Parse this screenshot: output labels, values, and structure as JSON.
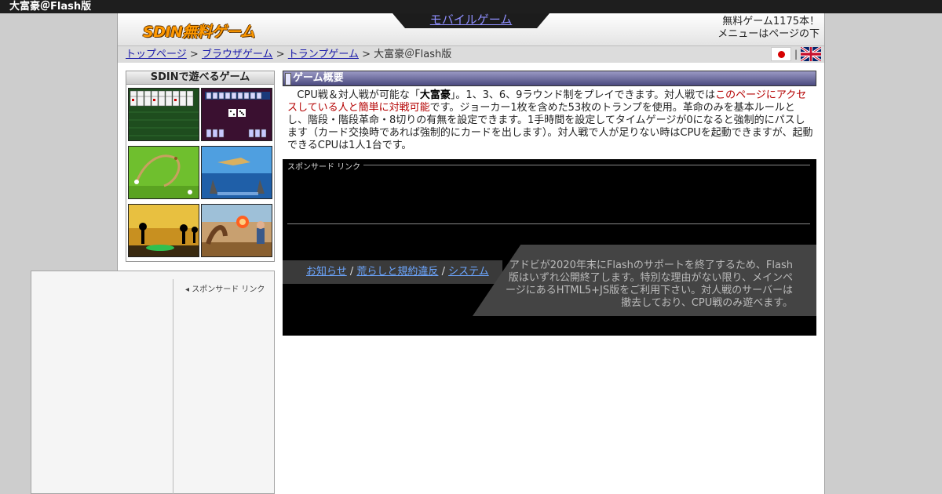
{
  "window": {
    "title": "大富豪＠Flash版"
  },
  "header": {
    "logo_text": "SDIN無料ゲーム",
    "mobile_link": "モバイルゲーム",
    "game_count": "無料ゲーム1175本！",
    "menu_hint": "メニューはページの下"
  },
  "breadcrumb": {
    "items": [
      "トップページ",
      "ブラウザゲーム",
      "トランプゲーム"
    ],
    "separator": ">",
    "current": "大富豪＠Flash版"
  },
  "flags": {
    "separator": "|"
  },
  "sidebar": {
    "games_title": "SDINで遊べるゲーム",
    "sponsor_label": "スポンサード リンク"
  },
  "overview": {
    "title": "ゲーム概要",
    "text_1": "CPU戦＆対人戦が可能な「",
    "game_name": "大富豪",
    "text_2": "」。1、3、6、9ラウンド制をプレイできます。対人戦では",
    "link_text": "このページにアクセスしている人と簡単に対戦可能",
    "text_3": "です。ジョーカー1枚を含めた53枚のトランプを使用。革命のみを基本ルールとし、階段・階段革命・8切りの有無を設定できます。1手時間を設定してタイムゲージが0になると強制的にパスします（カード交換時であれば強制的にカードを出します）。対人戦で人が足りない時はCPUを起動できますが、起動できるCPUは1人1台です。"
  },
  "sponsor": {
    "label": "スポンサード リンク"
  },
  "notices": {
    "links": [
      "お知らせ",
      "荒らしと規約違反",
      "システム"
    ],
    "separator": "/",
    "flash_notice": "アドビが2020年末にFlashのサポートを終了するため、Flash版はいずれ公開終了します。特別な理由がない限り、メインページにあるHTML5+JS版をご利用下さい。対人戦のサーバーは撤去しており、CPU戦のみ遊べます。"
  },
  "colors": {
    "titlebar": "#1e1e1e",
    "section_header": "#4b4a7f",
    "link": "#1a1aaa",
    "notice_link": "#6ca6ff",
    "highlight": "#b40000",
    "logo": "#ff9900"
  }
}
